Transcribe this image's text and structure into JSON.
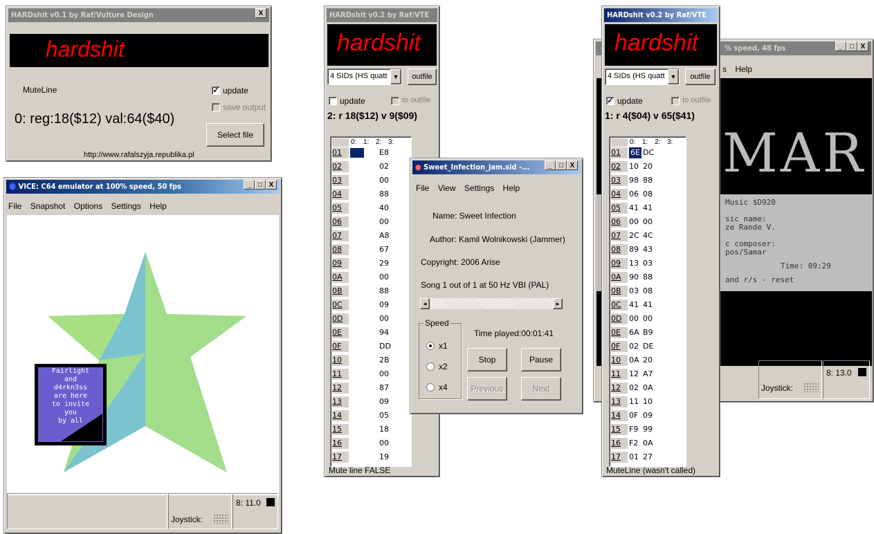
{
  "hs1": {
    "title": "HARDshit v0.1 by Raf/Vulture Design",
    "logo": "hardshit",
    "mute_line": "MuteLine",
    "update_label": "update",
    "save_output_label": "save output",
    "reg_text": "0: reg:18($12) val:64($40)",
    "select_file": "Select file",
    "url": "http://www.rafalszyja.republika.pl",
    "close": "X"
  },
  "vice1": {
    "title": "VICE: C64 emulator at 100% speed, 50 fps",
    "menu": [
      "File",
      "Snapshot",
      "Options",
      "Settings",
      "Help"
    ],
    "intro_text": [
      "Fairlight",
      "and",
      "d4rkn3ss",
      "are here",
      "to invite",
      "you",
      "by all"
    ],
    "drive": "8: 11.0",
    "joystick": "Joystick:",
    "win_btns": [
      "_",
      "□",
      "X"
    ]
  },
  "hs2": {
    "title": "HARDshit v0.2 by Raf/VTE",
    "logo": "hardshit",
    "select_value": "4 SIDs (HS quatt",
    "outfile": "outfile",
    "update_label": "update",
    "to_outfile_label": "to outfile",
    "reg_text": "2: r 18($12) v 9($09)",
    "cols": [
      "0:",
      "1:",
      "2:",
      "3:"
    ],
    "rows": [
      {
        "idx": "01",
        "v": "E8"
      },
      {
        "idx": "02",
        "v": "02"
      },
      {
        "idx": "03",
        "v": "00"
      },
      {
        "idx": "04",
        "v": "88"
      },
      {
        "idx": "05",
        "v": "40"
      },
      {
        "idx": "06",
        "v": "00"
      },
      {
        "idx": "07",
        "v": "A8"
      },
      {
        "idx": "08",
        "v": "67"
      },
      {
        "idx": "09",
        "v": "29"
      },
      {
        "idx": "0A",
        "v": "00"
      },
      {
        "idx": "0B",
        "v": "88"
      },
      {
        "idx": "0C",
        "v": "09"
      },
      {
        "idx": "0D",
        "v": "00"
      },
      {
        "idx": "0E",
        "v": "94"
      },
      {
        "idx": "0F",
        "v": "DD"
      },
      {
        "idx": "10",
        "v": "2B"
      },
      {
        "idx": "11",
        "v": "00"
      },
      {
        "idx": "12",
        "v": "87"
      },
      {
        "idx": "13",
        "v": "09"
      },
      {
        "idx": "14",
        "v": "05"
      },
      {
        "idx": "15",
        "v": "18"
      },
      {
        "idx": "16",
        "v": "00"
      },
      {
        "idx": "17",
        "v": "19"
      }
    ],
    "status": "Mute line FALSE"
  },
  "sid": {
    "title": "Sweet_Infection_jam.sid -...",
    "menu": [
      "File",
      "View",
      "Settings",
      "Help"
    ],
    "name": "Name: Sweet Infection",
    "author": "Author: Kamil Wolnikowski (Jammer)",
    "copyright": "Copyright: 2006 Arise",
    "song": "Song 1 out of 1 at 50 Hz VBI (PAL)",
    "speed_label": "Speed",
    "speeds": [
      "x1",
      "x2",
      "x4"
    ],
    "time_played": "Time played:00:01:41",
    "stop": "Stop",
    "pause": "Pause",
    "previous": "Previous",
    "next": "Next"
  },
  "hs3": {
    "title": "HARDshit v0.2 by Raf/VTE",
    "logo": "hardshit",
    "select_value": "4 SIDs (HS quatt",
    "outfile": "outfile",
    "update_label": "update",
    "to_outfile_label": "to outfile",
    "reg_text": "1: r 4($04) v 65($41)",
    "cols": [
      "0:",
      "1:",
      "2:",
      "3:"
    ],
    "rows": [
      {
        "idx": "01",
        "a": "6E",
        "b": "DC"
      },
      {
        "idx": "02",
        "a": "10",
        "b": "20"
      },
      {
        "idx": "03",
        "a": "98",
        "b": "88"
      },
      {
        "idx": "04",
        "a": "06",
        "b": "08"
      },
      {
        "idx": "05",
        "a": "41",
        "b": "41"
      },
      {
        "idx": "06",
        "a": "00",
        "b": "00"
      },
      {
        "idx": "07",
        "a": "2C",
        "b": "4C"
      },
      {
        "idx": "08",
        "a": "89",
        "b": "43"
      },
      {
        "idx": "09",
        "a": "13",
        "b": "03"
      },
      {
        "idx": "0A",
        "a": "90",
        "b": "88"
      },
      {
        "idx": "0B",
        "a": "03",
        "b": "08"
      },
      {
        "idx": "0C",
        "a": "41",
        "b": "41"
      },
      {
        "idx": "0D",
        "a": "00",
        "b": "00"
      },
      {
        "idx": "0E",
        "a": "6A",
        "b": "B9"
      },
      {
        "idx": "0F",
        "a": "02",
        "b": "DE"
      },
      {
        "idx": "10",
        "a": "0A",
        "b": "20"
      },
      {
        "idx": "11",
        "a": "12",
        "b": "A7"
      },
      {
        "idx": "12",
        "a": "02",
        "b": "0A"
      },
      {
        "idx": "13",
        "a": "11",
        "b": "10"
      },
      {
        "idx": "14",
        "a": "0F",
        "b": "09"
      },
      {
        "idx": "15",
        "a": "F9",
        "b": "99"
      },
      {
        "idx": "16",
        "a": "F2",
        "b": "0A"
      },
      {
        "idx": "17",
        "a": "01",
        "b": "27"
      }
    ],
    "status": "MuteLine (wasn't called)"
  },
  "vice2": {
    "title": "% speed, 48 fps",
    "menu": [
      "s",
      "Help"
    ],
    "logo": "MAR",
    "lines": [
      "Music $D920",
      "sic name:",
      "ze Rande V.",
      "c composer:",
      "pos/Samar",
      "Time: 09:29",
      "and r/s - reset"
    ],
    "drive": "8: 13.0",
    "joystick": "Joystick:"
  }
}
